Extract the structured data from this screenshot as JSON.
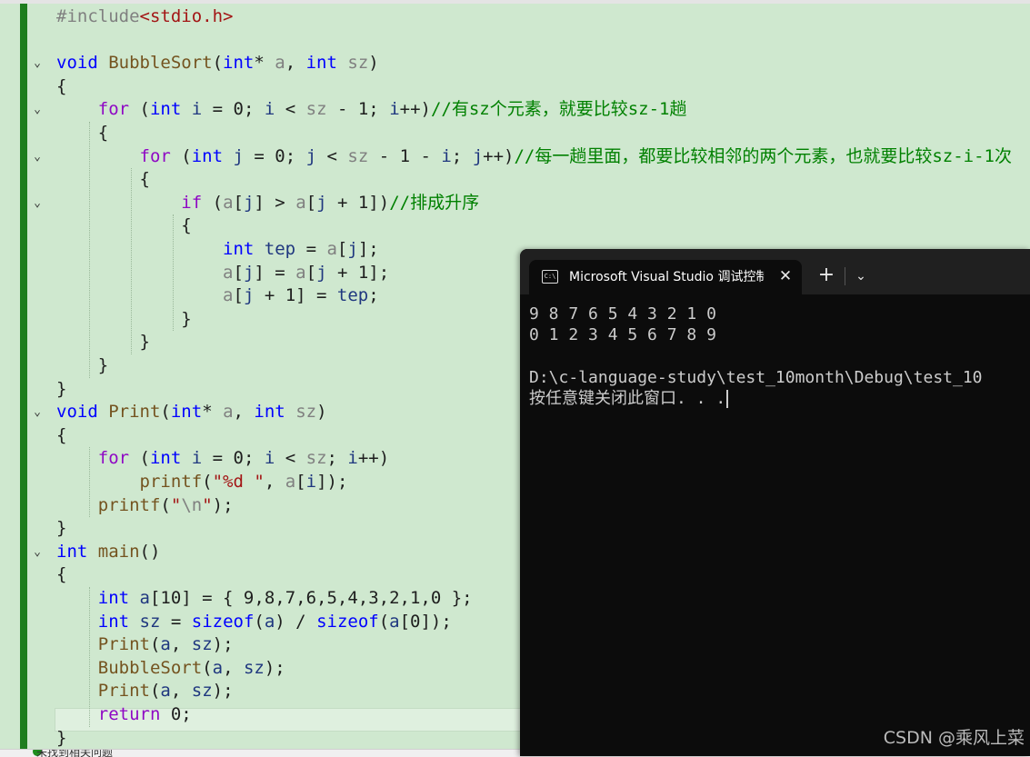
{
  "editor": {
    "lines": [
      {
        "t": [
          {
            "c": "pp",
            "s": "#include"
          },
          {
            "c": "str",
            "s": "<stdio.h>"
          }
        ]
      },
      {
        "t": []
      },
      {
        "fold": true,
        "t": [
          {
            "c": "kw",
            "s": "void "
          },
          {
            "c": "fn",
            "s": "BubbleSort"
          },
          {
            "s": "("
          },
          {
            "c": "kw",
            "s": "int"
          },
          {
            "s": "* "
          },
          {
            "c": "prm",
            "s": "a"
          },
          {
            "s": ", "
          },
          {
            "c": "kw",
            "s": "int "
          },
          {
            "c": "prm",
            "s": "sz"
          },
          {
            "s": ")"
          }
        ]
      },
      {
        "t": [
          {
            "s": "{"
          }
        ]
      },
      {
        "fold": true,
        "t": [
          {
            "s": "    "
          },
          {
            "c": "ctl",
            "s": "for"
          },
          {
            "s": " ("
          },
          {
            "c": "kw",
            "s": "int "
          },
          {
            "c": "var",
            "s": "i"
          },
          {
            "s": " = "
          },
          {
            "s": "0"
          },
          {
            "s": "; "
          },
          {
            "c": "var",
            "s": "i"
          },
          {
            "s": " < "
          },
          {
            "c": "prm",
            "s": "sz"
          },
          {
            "s": " - 1; "
          },
          {
            "c": "var",
            "s": "i"
          },
          {
            "s": "++)"
          },
          {
            "c": "cmt",
            "s": "//有sz个元素，就要比较sz-1趟"
          }
        ]
      },
      {
        "t": [
          {
            "s": "    {"
          }
        ]
      },
      {
        "fold": true,
        "t": [
          {
            "s": "        "
          },
          {
            "c": "ctl",
            "s": "for"
          },
          {
            "s": " ("
          },
          {
            "c": "kw",
            "s": "int "
          },
          {
            "c": "var",
            "s": "j"
          },
          {
            "s": " = 0; "
          },
          {
            "c": "var",
            "s": "j"
          },
          {
            "s": " < "
          },
          {
            "c": "prm",
            "s": "sz"
          },
          {
            "s": " - 1 - "
          },
          {
            "c": "var",
            "s": "i"
          },
          {
            "s": "; "
          },
          {
            "c": "var",
            "s": "j"
          },
          {
            "s": "++)"
          },
          {
            "c": "cmt",
            "s": "//每一趟里面，都要比较相邻的两个元素，也就要比较sz-i-1次"
          }
        ]
      },
      {
        "t": [
          {
            "s": "        {"
          }
        ]
      },
      {
        "fold": true,
        "t": [
          {
            "s": "            "
          },
          {
            "c": "ctl",
            "s": "if"
          },
          {
            "s": " ("
          },
          {
            "c": "prm",
            "s": "a"
          },
          {
            "s": "["
          },
          {
            "c": "var",
            "s": "j"
          },
          {
            "s": "] > "
          },
          {
            "c": "prm",
            "s": "a"
          },
          {
            "s": "["
          },
          {
            "c": "var",
            "s": "j"
          },
          {
            "s": " + 1])"
          },
          {
            "c": "cmt",
            "s": "//排成升序"
          }
        ]
      },
      {
        "t": [
          {
            "s": "            {"
          }
        ]
      },
      {
        "t": [
          {
            "s": "                "
          },
          {
            "c": "kw",
            "s": "int "
          },
          {
            "c": "var",
            "s": "tep"
          },
          {
            "s": " = "
          },
          {
            "c": "prm",
            "s": "a"
          },
          {
            "s": "["
          },
          {
            "c": "var",
            "s": "j"
          },
          {
            "s": "];"
          }
        ]
      },
      {
        "t": [
          {
            "s": "                "
          },
          {
            "c": "prm",
            "s": "a"
          },
          {
            "s": "["
          },
          {
            "c": "var",
            "s": "j"
          },
          {
            "s": "] = "
          },
          {
            "c": "prm",
            "s": "a"
          },
          {
            "s": "["
          },
          {
            "c": "var",
            "s": "j"
          },
          {
            "s": " + 1];"
          }
        ]
      },
      {
        "t": [
          {
            "s": "                "
          },
          {
            "c": "prm",
            "s": "a"
          },
          {
            "s": "["
          },
          {
            "c": "var",
            "s": "j"
          },
          {
            "s": " + 1] = "
          },
          {
            "c": "var",
            "s": "tep"
          },
          {
            "s": ";"
          }
        ]
      },
      {
        "t": [
          {
            "s": "            }"
          }
        ]
      },
      {
        "t": [
          {
            "s": "        }"
          }
        ]
      },
      {
        "t": [
          {
            "s": "    }"
          }
        ]
      },
      {
        "t": [
          {
            "s": "}"
          }
        ]
      },
      {
        "fold": true,
        "t": [
          {
            "c": "kw",
            "s": "void "
          },
          {
            "c": "fn",
            "s": "Print"
          },
          {
            "s": "("
          },
          {
            "c": "kw",
            "s": "int"
          },
          {
            "s": "* "
          },
          {
            "c": "prm",
            "s": "a"
          },
          {
            "s": ", "
          },
          {
            "c": "kw",
            "s": "int "
          },
          {
            "c": "prm",
            "s": "sz"
          },
          {
            "s": ")"
          }
        ]
      },
      {
        "t": [
          {
            "s": "{"
          }
        ]
      },
      {
        "t": [
          {
            "s": "    "
          },
          {
            "c": "ctl",
            "s": "for"
          },
          {
            "s": " ("
          },
          {
            "c": "kw",
            "s": "int "
          },
          {
            "c": "var",
            "s": "i"
          },
          {
            "s": " = 0; "
          },
          {
            "c": "var",
            "s": "i"
          },
          {
            "s": " < "
          },
          {
            "c": "prm",
            "s": "sz"
          },
          {
            "s": "; "
          },
          {
            "c": "var",
            "s": "i"
          },
          {
            "s": "++)"
          }
        ]
      },
      {
        "t": [
          {
            "s": "        "
          },
          {
            "c": "fn",
            "s": "printf"
          },
          {
            "s": "("
          },
          {
            "c": "str",
            "s": "\"%d \""
          },
          {
            "s": ", "
          },
          {
            "c": "prm",
            "s": "a"
          },
          {
            "s": "["
          },
          {
            "c": "var",
            "s": "i"
          },
          {
            "s": "]);"
          }
        ]
      },
      {
        "t": [
          {
            "s": "    "
          },
          {
            "c": "fn",
            "s": "printf"
          },
          {
            "s": "("
          },
          {
            "c": "str",
            "s": "\""
          },
          {
            "c": "prm",
            "s": "\\n"
          },
          {
            "c": "str",
            "s": "\""
          },
          {
            "s": ");"
          }
        ]
      },
      {
        "t": [
          {
            "s": "}"
          }
        ]
      },
      {
        "fold": true,
        "t": [
          {
            "c": "kw",
            "s": "int "
          },
          {
            "c": "fn",
            "s": "main"
          },
          {
            "s": "()"
          }
        ]
      },
      {
        "t": [
          {
            "s": "{"
          }
        ]
      },
      {
        "t": [
          {
            "s": "    "
          },
          {
            "c": "kw",
            "s": "int "
          },
          {
            "c": "var",
            "s": "a"
          },
          {
            "s": "[10] = { 9,8,7,6,5,4,3,2,1,0 };"
          }
        ]
      },
      {
        "t": [
          {
            "s": "    "
          },
          {
            "c": "kw",
            "s": "int "
          },
          {
            "c": "var",
            "s": "sz"
          },
          {
            "s": " = "
          },
          {
            "c": "kw",
            "s": "sizeof"
          },
          {
            "s": "("
          },
          {
            "c": "var",
            "s": "a"
          },
          {
            "s": ") / "
          },
          {
            "c": "kw",
            "s": "sizeof"
          },
          {
            "s": "("
          },
          {
            "c": "var",
            "s": "a"
          },
          {
            "s": "[0]);"
          }
        ]
      },
      {
        "t": [
          {
            "s": "    "
          },
          {
            "c": "fn",
            "s": "Print"
          },
          {
            "s": "("
          },
          {
            "c": "var",
            "s": "a"
          },
          {
            "s": ", "
          },
          {
            "c": "var",
            "s": "sz"
          },
          {
            "s": ");"
          }
        ]
      },
      {
        "t": [
          {
            "s": "    "
          },
          {
            "c": "fn",
            "s": "BubbleSort"
          },
          {
            "s": "("
          },
          {
            "c": "var",
            "s": "a"
          },
          {
            "s": ", "
          },
          {
            "c": "var",
            "s": "sz"
          },
          {
            "s": ");"
          }
        ]
      },
      {
        "t": [
          {
            "s": "    "
          },
          {
            "c": "fn",
            "s": "Print"
          },
          {
            "s": "("
          },
          {
            "c": "var",
            "s": "a"
          },
          {
            "s": ", "
          },
          {
            "c": "var",
            "s": "sz"
          },
          {
            "s": ");"
          }
        ]
      },
      {
        "t": [
          {
            "s": "    "
          },
          {
            "c": "ctl",
            "s": "return"
          },
          {
            "s": " 0;"
          }
        ]
      },
      {
        "t": [
          {
            "s": "}"
          }
        ]
      }
    ]
  },
  "statusbar": {
    "text": "未找到相关问题"
  },
  "terminal": {
    "tab_icon_label": "C:\\",
    "tab_title": "Microsoft Visual Studio 调试控制台",
    "close_glyph": "✕",
    "new_tab_glyph": "+",
    "dropdown_glyph": "⌄",
    "output": [
      "9 8 7 6 5 4 3 2 1 0",
      "0 1 2 3 4 5 6 7 8 9",
      "",
      "D:\\c-language-study\\test_10month\\Debug\\test_10",
      "按任意键关闭此窗口. . ."
    ]
  },
  "watermark": "CSDN @乘风上菜"
}
